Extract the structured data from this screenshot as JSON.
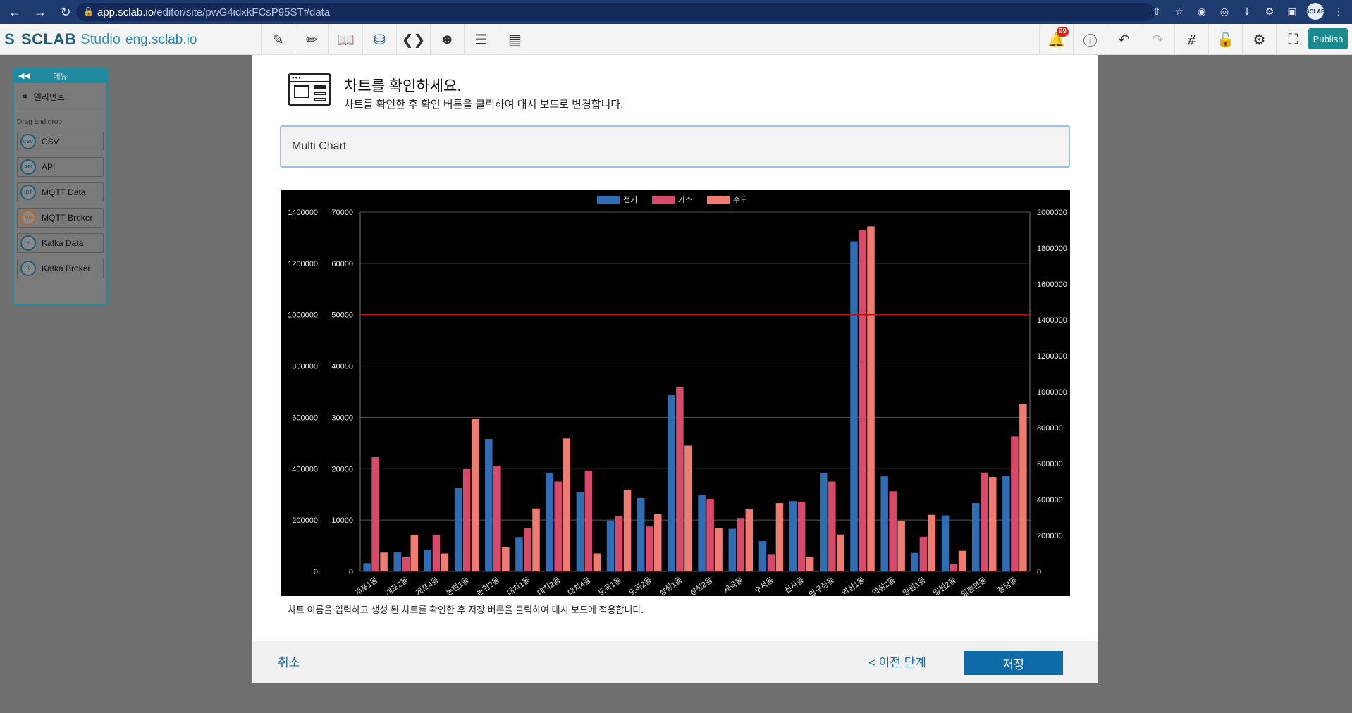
{
  "browser": {
    "url_host": "app.sclab.io",
    "url_path": "/editor/site/pwG4idxkFCsP95STf/data",
    "profile_label": "SCLAB"
  },
  "app": {
    "logo_text": "SCLAB",
    "logo_sub": "Studio",
    "site_name": "eng.sclab.io",
    "notification_count": "99",
    "publish_label": "Publish"
  },
  "sidebar": {
    "header": "메뉴",
    "element_label": "엘리먼트",
    "drag_label": "Drag and drop",
    "items": [
      {
        "label": "CSV",
        "icon": "CSV"
      },
      {
        "label": "API",
        "icon": "API"
      },
      {
        "label": "MQTT Data",
        "icon": "IOT"
      },
      {
        "label": "MQTT Broker",
        "icon": "MB"
      },
      {
        "label": "Kafka Data",
        "icon": "K"
      },
      {
        "label": "Kafka Broker",
        "icon": "K"
      }
    ]
  },
  "modal": {
    "title": "차트를 확인하세요.",
    "subtitle": "차트를 확인한 후 확인 버튼을 클릭하여 대시 보드로 변경합니다.",
    "chart_name": "Multi Chart",
    "help_text": "차트 이름을 입력하고 생성 된 차트를 확인한 후 저장 버튼을 클릭하여 대시 보드에 적용합니다.",
    "cancel_label": "취소",
    "prev_label": "< 이전 단계",
    "save_label": "저장"
  },
  "chart_data": {
    "type": "bar",
    "categories": [
      "개포1동",
      "개포2동",
      "개포4동",
      "논현1동",
      "논현2동",
      "대치1동",
      "대치2동",
      "대치4동",
      "도곡1동",
      "도곡2동",
      "삼성1동",
      "삼성2동",
      "세곡동",
      "수서동",
      "신사동",
      "압구정동",
      "역삼1동",
      "역삼2동",
      "일원1동",
      "일원2동",
      "일원본동",
      "청담동"
    ],
    "series": [
      {
        "name": "전기",
        "axis": "left-inner",
        "color": "#2f6db5",
        "values": [
          1600,
          3700,
          4200,
          16200,
          25800,
          6700,
          19200,
          15400,
          9900,
          14300,
          34300,
          14900,
          8300,
          5900,
          13700,
          19100,
          64300,
          18500,
          3600,
          10900,
          13300,
          18600
        ]
      },
      {
        "name": "가스",
        "axis": "left-outer",
        "color": "#d94a6a",
        "values": [
          445000,
          55000,
          140000,
          398000,
          412000,
          168000,
          350000,
          393000,
          215000,
          175000,
          718000,
          283000,
          208000,
          65000,
          272000,
          350000,
          1330000,
          312000,
          135000,
          28000,
          385000,
          526000
        ]
      },
      {
        "name": "수도",
        "axis": "right",
        "color": "#f07b70",
        "values": [
          105000,
          200000,
          100000,
          850000,
          135000,
          350000,
          740000,
          100000,
          455000,
          320000,
          700000,
          240000,
          345000,
          380000,
          80000,
          205000,
          1920000,
          280000,
          315000,
          115000,
          525000,
          930000
        ]
      }
    ],
    "axes": {
      "left_outer": {
        "min": 0,
        "max": 1400000,
        "step": 200000
      },
      "left_inner": {
        "min": 0,
        "max": 70000,
        "step": 10000
      },
      "right": {
        "min": 0,
        "max": 2000000,
        "step": 200000
      }
    },
    "reference_line": {
      "axis": "left-inner",
      "value": 50000,
      "color": "#c21010"
    },
    "grid": true,
    "legend_position": "top-center"
  }
}
